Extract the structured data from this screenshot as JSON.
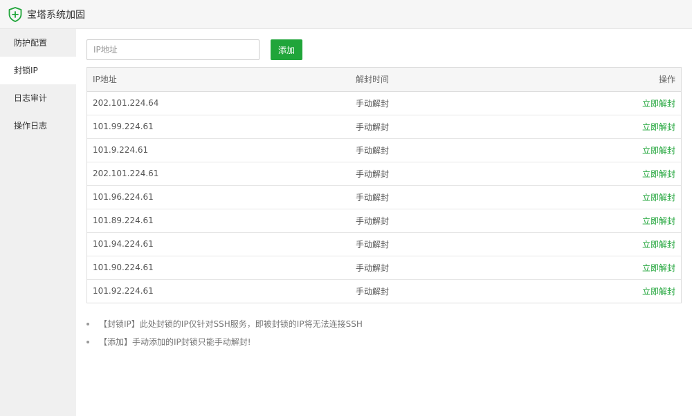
{
  "window": {
    "title": "宝塔系统加固",
    "logo_icon": "shield-plus-icon",
    "accent_color": "#20a53a"
  },
  "sidebar": {
    "items": [
      {
        "label": "防护配置",
        "active": false
      },
      {
        "label": "封锁IP",
        "active": true
      },
      {
        "label": "日志审计",
        "active": false
      },
      {
        "label": "操作日志",
        "active": false
      }
    ]
  },
  "toolbar": {
    "ip_placeholder": "IP地址",
    "ip_value": "",
    "add_label": "添加"
  },
  "table": {
    "headers": {
      "ip": "IP地址",
      "unlock_time": "解封时间",
      "action": "操作"
    },
    "rows": [
      {
        "ip": "202.101.224.64",
        "unlock_time": "手动解封",
        "action": "立即解封"
      },
      {
        "ip": "101.99.224.61",
        "unlock_time": "手动解封",
        "action": "立即解封"
      },
      {
        "ip": "101.9.224.61",
        "unlock_time": "手动解封",
        "action": "立即解封"
      },
      {
        "ip": "202.101.224.61",
        "unlock_time": "手动解封",
        "action": "立即解封"
      },
      {
        "ip": "101.96.224.61",
        "unlock_time": "手动解封",
        "action": "立即解封"
      },
      {
        "ip": "101.89.224.61",
        "unlock_time": "手动解封",
        "action": "立即解封"
      },
      {
        "ip": "101.94.224.61",
        "unlock_time": "手动解封",
        "action": "立即解封"
      },
      {
        "ip": "101.90.224.61",
        "unlock_time": "手动解封",
        "action": "立即解封"
      },
      {
        "ip": "101.92.224.61",
        "unlock_time": "手动解封",
        "action": "立即解封"
      }
    ]
  },
  "tips": [
    "【封锁IP】此处封锁的IP仅针对SSH服务，即被封锁的IP将无法连接SSH",
    "【添加】手动添加的IP封锁只能手动解封!"
  ]
}
